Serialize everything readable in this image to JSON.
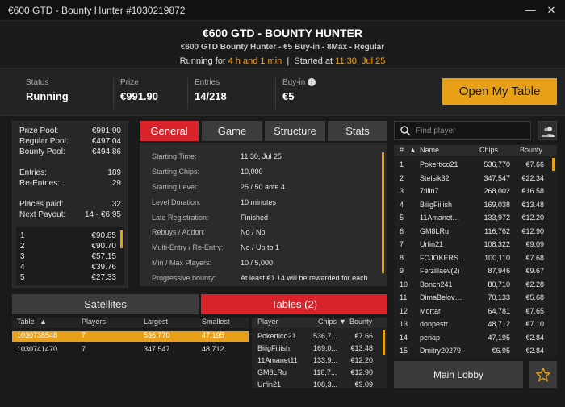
{
  "window": {
    "title": "€600 GTD - Bounty Hunter #1030219872",
    "minimize": "—",
    "close": "✕"
  },
  "header": {
    "title": "€600 GTD - BOUNTY HUNTER",
    "subtitle": "€600 GTD Bounty Hunter - €5 Buy-in - 8Max - Regular",
    "running_label": "Running for",
    "running_value": "4 h and 1 min",
    "separator": "|",
    "started_label": "Started at",
    "started_value": "11:30, Jul 25"
  },
  "status": {
    "status_label": "Status",
    "status_value": "Running",
    "prize_label": "Prize",
    "prize_value": "€991.90",
    "entries_label": "Entries",
    "entries_value": "14/218",
    "buyin_label": "Buy-in",
    "buyin_value": "€5"
  },
  "open_table_button": "Open My Table",
  "prize_panel": {
    "prize_pool_label": "Prize Pool:",
    "prize_pool": "€991.90",
    "regular_pool_label": "Regular Pool:",
    "regular_pool": "€497.04",
    "bounty_pool_label": "Bounty Pool:",
    "bounty_pool": "€494.86",
    "entries_label": "Entries:",
    "entries": "189",
    "reentries_label": "Re-Entries:",
    "reentries": "29",
    "places_paid_label": "Places paid:",
    "places_paid": "32",
    "next_payout_label": "Next Payout:",
    "next_payout": "14 - €6.95",
    "places": [
      {
        "place": "1",
        "amount": "€90.85"
      },
      {
        "place": "2",
        "amount": "€90.70"
      },
      {
        "place": "3",
        "amount": "€57.15"
      },
      {
        "place": "4",
        "amount": "€39.76"
      },
      {
        "place": "5",
        "amount": "€27.33"
      }
    ]
  },
  "tabs": [
    "General",
    "Game",
    "Structure",
    "Stats"
  ],
  "general": [
    {
      "k": "Starting Time:",
      "v": "11:30, Jul 25"
    },
    {
      "k": "Starting Chips:",
      "v": "10,000"
    },
    {
      "k": "Starting Level:",
      "v": "25 / 50 ante 4"
    },
    {
      "k": "Level Duration:",
      "v": "10 minutes"
    },
    {
      "k": "Late Registration:",
      "v": "Finished"
    },
    {
      "k": "Rebuys / Addon:",
      "v": "No / No"
    },
    {
      "k": "Multi-Entry / Re-Entry:",
      "v": "No / Up to 1"
    },
    {
      "k": "Min / Max Players:",
      "v": "10 / 5,000"
    },
    {
      "k": "Progressive bounty:",
      "v": "At least €1.14 will be rewarded for each"
    }
  ],
  "subtabs": {
    "satellites": "Satellites",
    "tables": "Tables (2)"
  },
  "tables_table": {
    "headers": {
      "table": "Table",
      "sort": "▲",
      "players": "Players",
      "largest": "Largest",
      "smallest": "Smallest"
    },
    "rows": [
      {
        "table": "1030738548",
        "players": "7",
        "largest": "536,770",
        "smallest": "47,195"
      },
      {
        "table": "1030741470",
        "players": "7",
        "largest": "347,547",
        "smallest": "48,712"
      }
    ]
  },
  "table_players": {
    "headers": {
      "player": "Player",
      "chips": "Chips",
      "sort": "▼",
      "bounty": "Bounty"
    },
    "rows": [
      {
        "player": "Pokertico21",
        "chips": "536,7...",
        "bounty": "€7.66"
      },
      {
        "player": "BiiigFiiiish",
        "chips": "169,0...",
        "bounty": "€13.48"
      },
      {
        "player": "11Amanet11",
        "chips": "133,9...",
        "bounty": "€12.20"
      },
      {
        "player": "GM8LRu",
        "chips": "116,7...",
        "bounty": "€12.90"
      },
      {
        "player": "Urfin21",
        "chips": "108,3...",
        "bounty": "€9.09"
      }
    ]
  },
  "search": {
    "placeholder": "Find player"
  },
  "player_list": {
    "headers": {
      "rank": "#",
      "sort": "▲",
      "name": "Name",
      "chips": "Chips",
      "bounty": "Bounty"
    },
    "rows": [
      {
        "rank": "1",
        "name": "Pokertico21",
        "chips": "536,770",
        "bounty": "€7.66"
      },
      {
        "rank": "2",
        "name": "Stelsik32",
        "chips": "347,547",
        "bounty": "€22.34"
      },
      {
        "rank": "3",
        "name": "7filin7",
        "chips": "268,002",
        "bounty": "€16.58"
      },
      {
        "rank": "4",
        "name": "BiiigFiiiish",
        "chips": "169,038",
        "bounty": "€13.48"
      },
      {
        "rank": "5",
        "name": "11Amanet…",
        "chips": "133,972",
        "bounty": "€12.20"
      },
      {
        "rank": "6",
        "name": "GM8LRu",
        "chips": "116,762",
        "bounty": "€12.90"
      },
      {
        "rank": "7",
        "name": "Urfin21",
        "chips": "108,322",
        "bounty": "€9.09"
      },
      {
        "rank": "8",
        "name": "FCJOKERS…",
        "chips": "100,110",
        "bounty": "€7.68"
      },
      {
        "rank": "9",
        "name": "Ferzillaev(2)",
        "chips": "87,946",
        "bounty": "€9.67"
      },
      {
        "rank": "10",
        "name": "Bonch241",
        "chips": "80,710",
        "bounty": "€2.28"
      },
      {
        "rank": "11",
        "name": "DimaBelov…",
        "chips": "70,133",
        "bounty": "€5.68"
      },
      {
        "rank": "12",
        "name": "Mortar",
        "chips": "64,781",
        "bounty": "€7.65"
      },
      {
        "rank": "13",
        "name": "donpestr",
        "chips": "48,712",
        "bounty": "€7.10"
      },
      {
        "rank": "14",
        "name": "periap",
        "chips": "47,195",
        "bounty": "€2.84"
      },
      {
        "rank": "15",
        "name": "Dmitry20279",
        "chips": "€6.95",
        "bounty": "€2.84"
      }
    ]
  },
  "main_lobby_button": "Main Lobby",
  "colors": {
    "accent": "#e8a018",
    "active_tab": "#d8232a"
  },
  "icons": [
    "info-icon",
    "search-icon",
    "players-icon",
    "star-icon",
    "close-icon",
    "minimize-icon"
  ]
}
